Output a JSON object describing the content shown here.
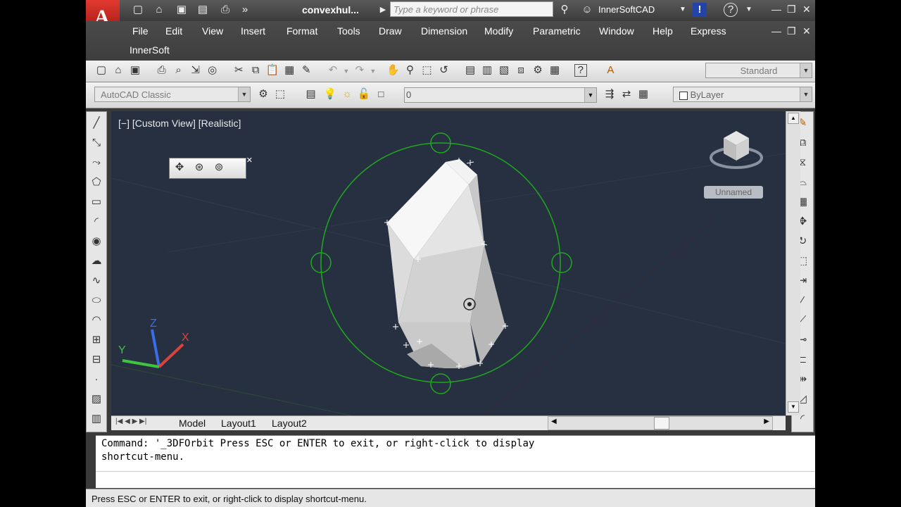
{
  "app": {
    "logo_letter": "A",
    "document_title": "convexhul...",
    "search_placeholder": "Type a keyword or phrase",
    "user_name": "InnerSoftCAD"
  },
  "menubar": {
    "items": [
      "File",
      "Edit",
      "View",
      "Insert",
      "Format",
      "Tools",
      "Draw",
      "Dimension",
      "Modify",
      "Parametric",
      "Window",
      "Help",
      "Express"
    ],
    "second_row": "InnerSoft"
  },
  "toolbar": {
    "text_style": "Standard",
    "workspace": "AutoCAD Classic",
    "layer": "0",
    "color": "ByLayer"
  },
  "viewport": {
    "label": "[−] [Custom View] [Realistic]",
    "viewcube_label": "Unnamed",
    "axis_x": "X",
    "axis_y": "Y",
    "axis_z": "Z"
  },
  "tabs": [
    "Model",
    "Layout1",
    "Layout2"
  ],
  "command": {
    "history": "Command: '_3DFOrbit Press ESC or ENTER to exit, or right-click to display\nshortcut-menu.",
    "input": ""
  },
  "status": {
    "text": "Press ESC or ENTER to exit, or right-click to display shortcut-menu."
  },
  "colors": {
    "viewport_bg": "#263040",
    "orbit_ring": "#1fa81f",
    "solid": "#e8e8e8"
  }
}
